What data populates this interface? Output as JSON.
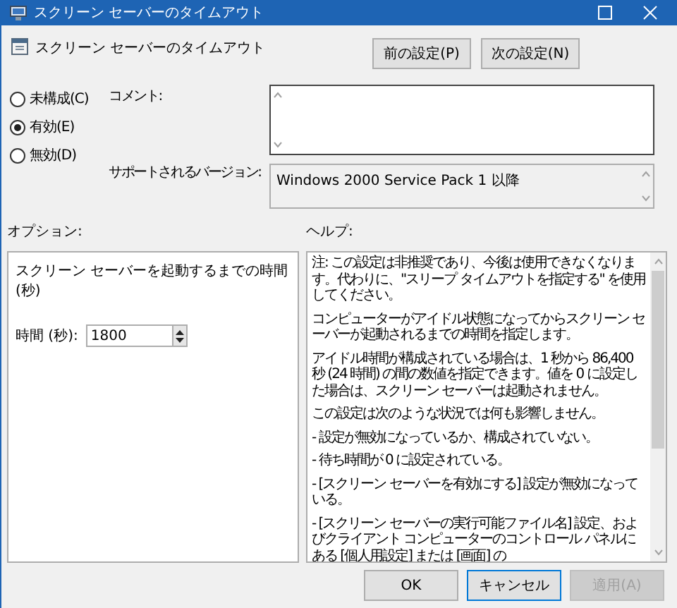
{
  "window": {
    "title": "スクリーン セーバーのタイムアウト"
  },
  "header": {
    "title": "スクリーン セーバーのタイムアウト",
    "buttons": [
      "前の設定(P)",
      "次の設定(N)"
    ]
  },
  "state_options": [
    {
      "label": "未構成(C)",
      "selected": false
    },
    {
      "label": "有効(E)",
      "selected": true
    },
    {
      "label": "無効(D)",
      "selected": false
    }
  ],
  "comment": {
    "label": "コメント:"
  },
  "supported_on": {
    "label": "サポートされるバージョン:",
    "value": "Windows 2000 Service Pack 1 以降"
  },
  "options": {
    "heading": "オプション:",
    "description": "スクリーン セーバーを起動するまでの時間 (秒)",
    "field_label": "時間 (秒):",
    "value": "1800"
  },
  "help": {
    "heading": "ヘルプ:",
    "paragraphs": [
      "注: この設定は非推奨であり、今後は使用できなくなります。代わりに、\"スリープ タイムアウトを指定する\" を使用してください。",
      "コンピューターがアイドル状態になってからスクリーン セーバーが起動されるまでの時間を指定します。",
      "アイドル時間が構成されている場合は、1 秒から 86,400 秒 (24 時間) の間の数値を指定できます。値を 0 に設定した場合は、スクリーン セーバーは起動されません。",
      "この設定は次のような状況では何も影響しません。",
      "- 設定が無効になっているか、構成されていない。",
      "- 待ち時間が 0 に設定されている。",
      "- [スクリーン セーバーを有効にする] 設定が無効になっている。",
      "- [スクリーン セーバーの実行可能ファイル名] 設定、およびクライアント コンピューターのコントロール パネルにある [個人用設定] または [画面] の"
    ]
  },
  "buttons": [
    {
      "label": "OK",
      "disabled": false,
      "focused": false
    },
    {
      "label": "キャンセル",
      "disabled": false,
      "focused": true
    },
    {
      "label": "適用(A)",
      "disabled": true,
      "focused": false
    }
  ]
}
